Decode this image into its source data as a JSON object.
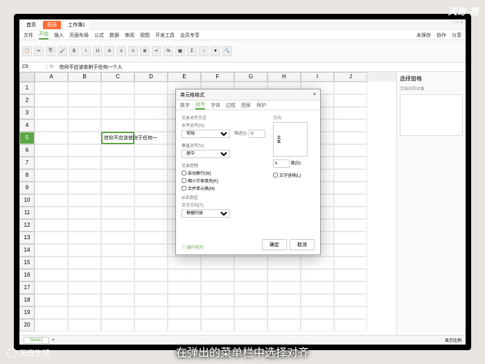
{
  "watermarks": {
    "top_right": "天奇·视",
    "bottom_left": "天奇生活"
  },
  "subtitle": "在弹出的菜单栏中选择对齐",
  "titlebar": {
    "tab1": "首页",
    "tab2": "稻壳",
    "tab3": "工作簿1"
  },
  "menu": {
    "file": "文件",
    "m1": "开始",
    "m2": "插入",
    "m3": "页面布局",
    "m4": "公式",
    "m5": "数据",
    "m6": "审阅",
    "m7": "视图",
    "m8": "开发工具",
    "m9": "会员专享",
    "right1": "未保存",
    "right2": "协作",
    "right3": "分享"
  },
  "formula": {
    "cell_ref": "C5",
    "content": "信仰不应该依附于任何一个人"
  },
  "columns": [
    "A",
    "B",
    "C",
    "D",
    "E",
    "F",
    "G",
    "H",
    "I",
    "J"
  ],
  "cell_text": "信仰不应该依附于任何一",
  "side": {
    "title": "选择窗格",
    "sub": "文档中的对象"
  },
  "dialog": {
    "title": "单元格格式",
    "tabs": {
      "t1": "数字",
      "t2": "对齐",
      "t3": "字体",
      "t4": "边框",
      "t5": "图案",
      "t6": "保护"
    },
    "text_align": "文本对齐方式",
    "horiz": "水平对齐(H):",
    "horiz_val": "常规",
    "indent": "缩进(I):",
    "indent_val": "0",
    "vert": "垂直对齐(V):",
    "vert_val": "居中",
    "text_ctrl": "文本控制",
    "wrap": "自动换行(W)",
    "shrink": "缩小字体填充(K)",
    "merge": "合并单元格(M)",
    "rtl": "从右到左",
    "text_dir": "文字方向(T):",
    "dir_val": "根据内容",
    "orient": "方向",
    "orient_text": "文本",
    "degree": "度(D)",
    "deg_val": "0",
    "stack": "文字竖排(L)",
    "ok": "确定",
    "cancel": "取消",
    "help": "操作技巧"
  },
  "sheet": "Sheet1",
  "status_right": "显示比例"
}
